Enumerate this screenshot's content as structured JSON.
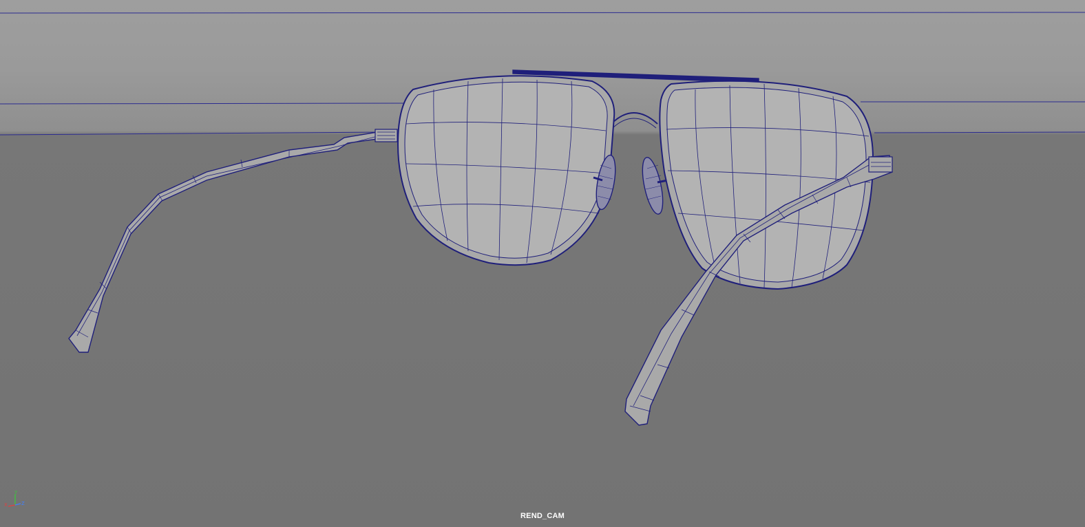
{
  "viewport": {
    "camera_name": "REND_CAM",
    "background_color": "#757575",
    "wireframe_color": "#1f1f7a",
    "shaded_color": "#a9a9a9"
  },
  "axis_gizmo": {
    "icon": "axis-orientation-icon",
    "x_label": "X",
    "y_label": "Y",
    "z_label": "Z",
    "x_color": "#e04040",
    "y_color": "#40c040",
    "z_color": "#4080ff"
  },
  "model": {
    "name": "aviator-sunglasses-icon"
  }
}
